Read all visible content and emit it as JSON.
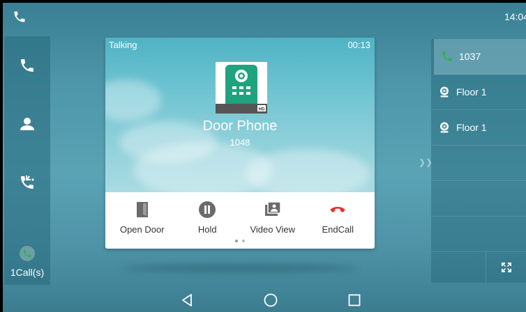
{
  "status_bar": {
    "time": "14:04",
    "icon": "phone-icon"
  },
  "sidebar": {
    "items": [
      {
        "icon": "phone-icon"
      },
      {
        "icon": "contact-icon"
      },
      {
        "icon": "call-history-icon"
      }
    ],
    "calls_label": "1Call(s)"
  },
  "call": {
    "state": "Talking",
    "duration": "00:13",
    "name": "Door Phone",
    "number": "1048",
    "badge": "HD"
  },
  "actions": [
    {
      "label": "Open Door",
      "icon": "door-icon"
    },
    {
      "label": "Hold",
      "icon": "pause-icon"
    },
    {
      "label": "Video View",
      "icon": "video-view-icon"
    },
    {
      "label": "EndCall",
      "icon": "end-call-icon"
    }
  ],
  "lines": [
    {
      "label": "1037",
      "icon": "phone-icon"
    },
    {
      "label": "Floor 1",
      "icon": "camera-icon"
    },
    {
      "label": "Floor 1",
      "icon": "camera-icon"
    }
  ],
  "colors": {
    "accent_green": "#2fb34a",
    "end_call_red": "#e3342f",
    "icon_gray": "#6b6b6b"
  }
}
